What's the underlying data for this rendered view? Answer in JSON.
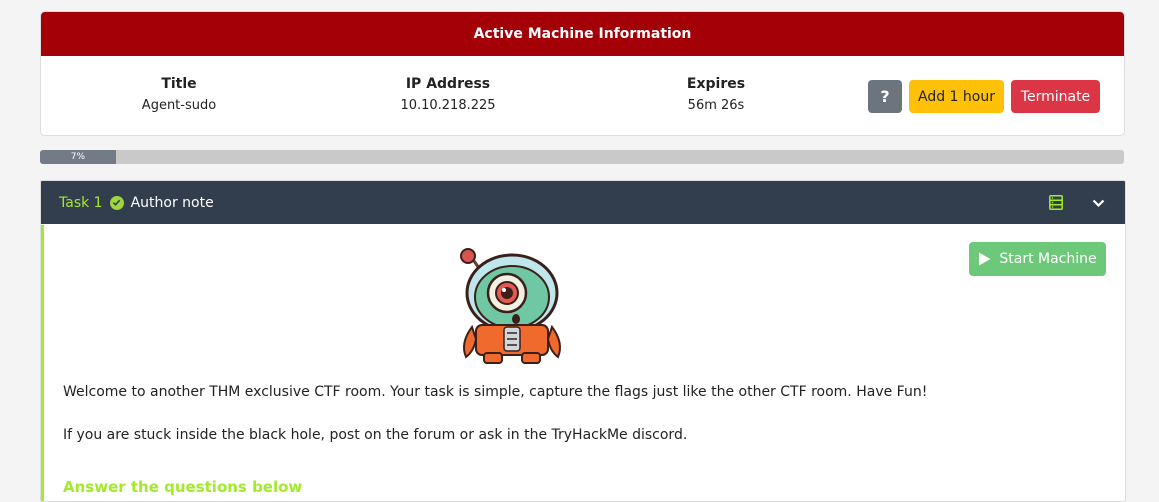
{
  "machine": {
    "header": "Active Machine Information",
    "title_label": "Title",
    "title_value": "Agent-sudo",
    "ip_label": "IP Address",
    "ip_value": "10.10.218.225",
    "expires_label": "Expires",
    "expires_value": "56m 26s",
    "help_label": "?",
    "add_hour_label": "Add 1 hour",
    "terminate_label": "Terminate"
  },
  "progress": {
    "label": "7%",
    "percent": 7
  },
  "task": {
    "number": "Task 1",
    "title": "Author note",
    "start_machine_label": "Start Machine",
    "paragraph1": "Welcome to another THM exclusive CTF room. Your task is simple, capture the flags just like the other CTF room. Have Fun!",
    "paragraph2": "If you are stuck inside the black hole, post on the forum or ask in the TryHackMe discord.",
    "answer_heading": "Answer the questions below"
  },
  "colors": {
    "header_red": "#a30007",
    "task_header": "#323d4e",
    "accent_green": "#a3ea2a",
    "add_yellow": "#ffc107",
    "terminate_red": "#dc3545",
    "start_green": "#6dc87a"
  },
  "icons": [
    "check-circle-icon",
    "server-icon",
    "chevron-down-icon",
    "play-icon",
    "alien-mascot"
  ]
}
